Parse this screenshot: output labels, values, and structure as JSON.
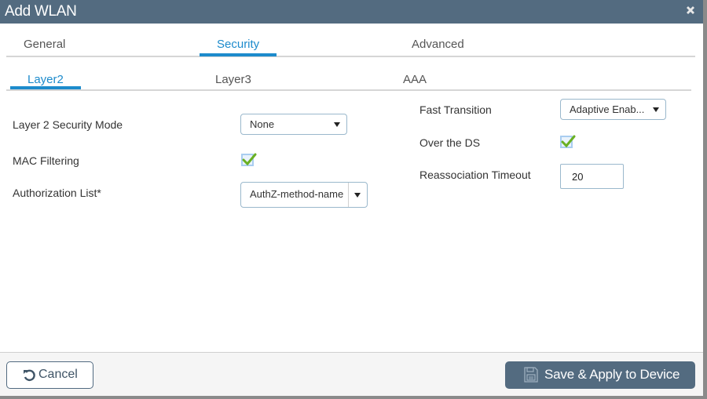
{
  "dialog": {
    "title": "Add WLAN",
    "close_icon": "close-icon"
  },
  "main_tabs": [
    {
      "label": "General",
      "active": false
    },
    {
      "label": "Security",
      "active": true
    },
    {
      "label": "Advanced",
      "active": false
    }
  ],
  "sub_tabs": [
    {
      "label": "Layer2",
      "active": true
    },
    {
      "label": "Layer3",
      "active": false
    },
    {
      "label": "AAA",
      "active": false
    }
  ],
  "left_form": {
    "layer2_security_mode": {
      "label": "Layer 2 Security Mode",
      "value": "None"
    },
    "mac_filtering": {
      "label": "MAC Filtering",
      "checked": true
    },
    "authorization_list": {
      "label": "Authorization List*",
      "value": "AuthZ-method-name"
    }
  },
  "right_form": {
    "fast_transition": {
      "label": "Fast Transition",
      "value": "Adaptive Enab..."
    },
    "over_the_ds": {
      "label": "Over the DS",
      "checked": true
    },
    "reassociation_timeout": {
      "label": "Reassociation Timeout",
      "value": "20"
    }
  },
  "footer": {
    "cancel_label": "Cancel",
    "cancel_icon": "undo-icon",
    "save_label": "Save & Apply to Device",
    "save_icon": "save-icon"
  },
  "colors": {
    "header_bg": "#536b80",
    "accent": "#1d8bcc",
    "check_green": "#6ab023"
  }
}
